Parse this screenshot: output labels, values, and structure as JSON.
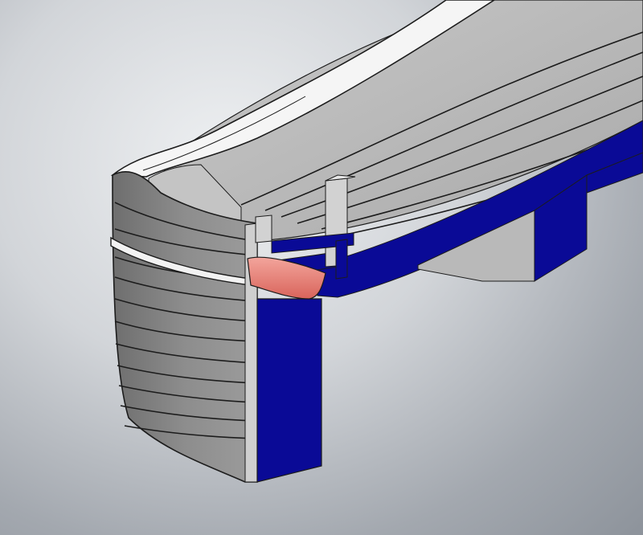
{
  "viewport": {
    "view": "3d-model-section",
    "colors": {
      "background_light": "#eef0f2",
      "background_dark": "#8d939b",
      "hull_shell": "#8a8a8a",
      "hull_shell_dark": "#6f6f6f",
      "interior": "#b5b5b5",
      "gunwale": "#f4f4f4",
      "section_cut": "#0a0a96",
      "keel_section": "#e8776e"
    }
  }
}
